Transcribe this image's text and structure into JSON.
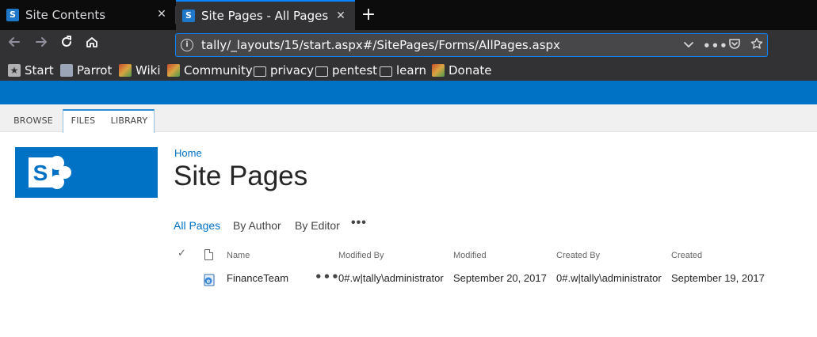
{
  "browser": {
    "tabs": [
      {
        "favicon": "sharepoint-icon",
        "label": "Site Contents",
        "active": false
      },
      {
        "favicon": "sharepoint-icon",
        "label": "Site Pages - All Pages",
        "active": true
      }
    ],
    "new_tab_symbol": "+",
    "close_symbol": "✕",
    "url": "tally/_layouts/15/start.aspx#/SitePages/Forms/AllPages.aspx",
    "nav_icons": [
      "back-arrow-icon",
      "forward-arrow-icon",
      "reload-icon",
      "home-icon"
    ],
    "url_icons": [
      "info-icon",
      "dropdown-chevron-icon",
      "more-actions-icon",
      "pocket-icon",
      "bookmark-star-icon"
    ],
    "bookmarks": [
      {
        "label": "Start",
        "icon": "star-icon"
      },
      {
        "label": "Parrot",
        "icon": "parrot-icon"
      },
      {
        "label": "Wiki",
        "icon": "wiki-icon"
      },
      {
        "label": "Community",
        "icon": "community-icon"
      },
      {
        "label": "privacy",
        "icon": "folder-icon"
      },
      {
        "label": "pentest",
        "icon": "folder-icon"
      },
      {
        "label": "learn",
        "icon": "folder-icon"
      },
      {
        "label": "Donate",
        "icon": "donate-icon"
      }
    ]
  },
  "colors": {
    "accent": "#0072c6",
    "browser_dark": "#0c0c0d",
    "browser_toolbar": "#323234",
    "focus_ring": "#0a84ff"
  },
  "ribbon": {
    "tabs": [
      "BROWSE",
      "FILES",
      "LIBRARY"
    ]
  },
  "page": {
    "breadcrumb": "Home",
    "title": "Site Pages",
    "views": [
      "All Pages",
      "By Author",
      "By Editor"
    ],
    "views_more": "•••",
    "active_view": "All Pages"
  },
  "table": {
    "headers": [
      "Name",
      "Modified By",
      "Modified",
      "Created By",
      "Created"
    ],
    "rows": [
      {
        "name": "FinanceTeam",
        "modified_by": "0#.w|tally\\administrator",
        "modified": "September 20, 2017",
        "created_by": "0#.w|tally\\administrator",
        "created": "September 19, 2017",
        "icon": "aspx-page-icon"
      }
    ],
    "row_more": "•••"
  }
}
